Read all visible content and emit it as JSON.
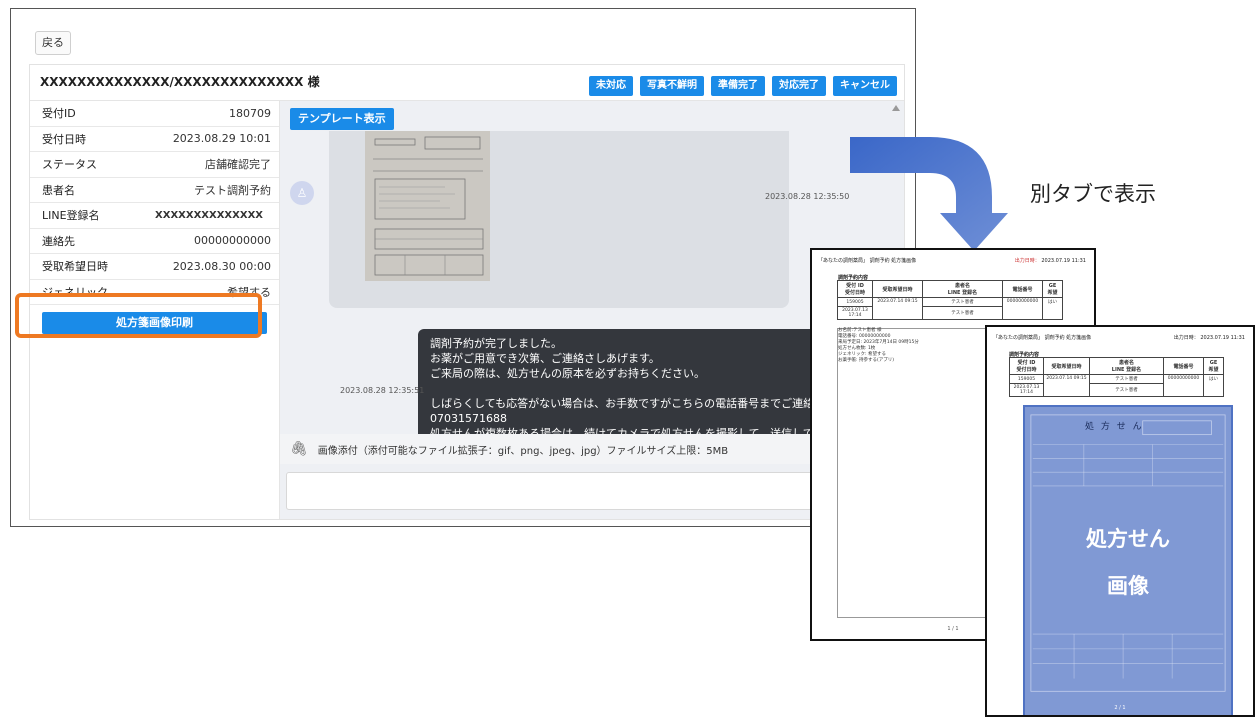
{
  "app": {
    "back_label": "戻る",
    "patient_name": "XXXXXXXXXXXXXX/XXXXXXXXXXXXXX 様",
    "actions": [
      "未対応",
      "写真不鮮明",
      "準備完了",
      "対応完了",
      "キャンセル"
    ],
    "info": [
      {
        "label": "受付ID",
        "value": "180709"
      },
      {
        "label": "受付日時",
        "value": "2023.08.29 10:01"
      },
      {
        "label": "ステータス",
        "value": "店舗確認完了"
      },
      {
        "label": "患者名",
        "value": "テスト調剤予約"
      },
      {
        "label": "LINE登録名",
        "value": "XXXXXXXXXXXXXX"
      },
      {
        "label": "連絡先",
        "value": "00000000000"
      },
      {
        "label": "受取希望日時",
        "value": "2023.08.30 00:00"
      },
      {
        "label": "ジェネリック",
        "value": "希望する"
      }
    ],
    "print_button": "処方箋画像印刷",
    "template_button": "テンプレート表示",
    "timestamp_image": "2023.08.28 12:35:50",
    "timestamp_reply": "2023.08.28 12:35:51",
    "reply_lines": [
      "調剤予約が完了しました。",
      "お薬がご用意でき次第、ご連絡さしあげます。",
      "ご来局の際は、処方せんの原本を必ずお持ちください。",
      "",
      "しばらくしても応答がない場合は、お手数ですがこちらの電話番号までご連絡ください。",
      "07031571688",
      "処方せんが複数枚ある場合は、続けてカメラで処方せんを撮影して、送信してください。"
    ],
    "attach_text": "画像添付（添付可能なファイル拡張子：gif、png、jpeg、jpg）ファイルサイズ上限：5MB"
  },
  "caption": "別タブで表示",
  "print_doc": {
    "title": "「あなたの調剤薬局」 調剤予約 処方箋画像",
    "date_label": "出力日時：",
    "date_value": "2023.07.19 11:31",
    "section": "調剤予約内容",
    "headers": [
      "受付 ID\n受付日時",
      "受取希望日時",
      "患者名\nLINE 登録名",
      "電話番号",
      "GE\n希望"
    ],
    "row1": [
      "159005",
      "2023.07.14 09:15",
      "テスト患者",
      "00000000000",
      "はい"
    ],
    "row2": [
      "2023.07.13 17:14",
      "",
      "テスト患者",
      "",
      ""
    ],
    "notes": "お名前:テスト患者 様\n電話番号: 00000000000\n来局予定日: 2023年7月14日 09時15分\n処方せん枚数: 1枚\nジェネリック: 希望する\nお薬手帳: 持参する(アプリ)",
    "page_1": "1 / 1",
    "page_2": "2 / 1"
  },
  "overlay": {
    "line1": "処方せん",
    "line2": "画像",
    "rx_heading": "処 方 せ ん"
  },
  "colors": {
    "accent": "#1a8be8",
    "highlight": "#ee7922",
    "arrow": "#4a72c4",
    "overlay": "#4f72c3"
  }
}
